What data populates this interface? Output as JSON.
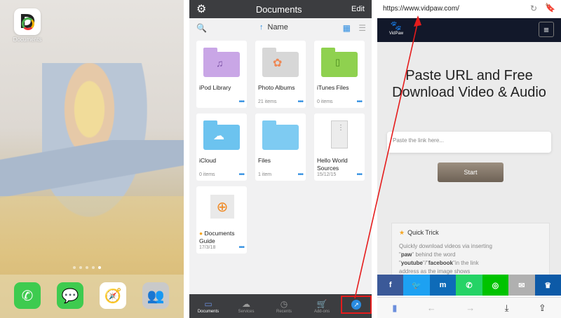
{
  "home": {
    "app_label": "Documents",
    "page_dots": 5,
    "active_dot": 4
  },
  "docs": {
    "title": "Documents",
    "edit_label": "Edit",
    "sort_label": "Name",
    "items": [
      {
        "name": "iPod Library",
        "meta": ""
      },
      {
        "name": "Photo Albums",
        "meta": "21 items"
      },
      {
        "name": "iTunes Files",
        "meta": "0 items"
      },
      {
        "name": "iCloud",
        "meta": "0 items"
      },
      {
        "name": "Files",
        "meta": "1 item"
      },
      {
        "name": "Hello World Sources",
        "meta": "15/12/15"
      },
      {
        "name": "Documents Guide",
        "meta": "17/3/18"
      }
    ],
    "tabs": [
      "Documents",
      "Services",
      "Recents",
      "Add-ons"
    ]
  },
  "browser": {
    "url": "https://www.vidpaw.com/",
    "logo_label": "VidPaw",
    "headline": "Paste URL and Free Download Video & Audio",
    "link_placeholder": "Paste the link here...",
    "start_label": "Start",
    "trick_title": "Quick Trick",
    "trick_line1": "Quickly download videos via inserting",
    "trick_quote_open": "\"",
    "trick_paw": "paw",
    "trick_quote_close": "\"",
    "trick_line2": " behind the word",
    "trick_youtube": "youtube",
    "trick_slash": "\"/\"",
    "trick_facebook": "facebook",
    "trick_line3": "\"in the link",
    "trick_line4": "address as the image shows",
    "share_colors": [
      "#3b5998",
      "#1da1f2",
      "#0077b5",
      "#25d366",
      "#00c300",
      "#b0b0b0",
      "#0d5aa7"
    ]
  }
}
